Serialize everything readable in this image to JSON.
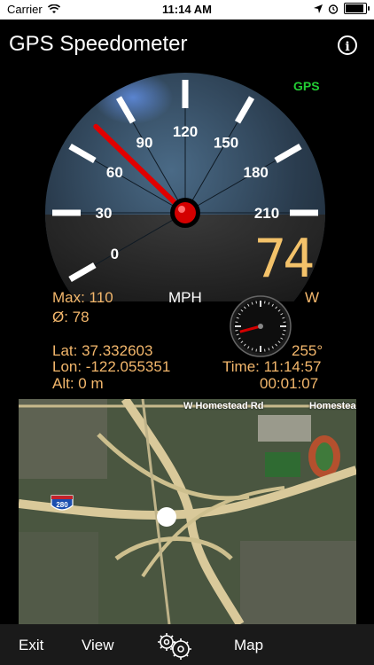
{
  "status_bar": {
    "carrier": "Carrier",
    "time": "11:14 AM",
    "battery_level": 0.9,
    "icons": [
      "wifi-icon",
      "location-arrow-icon",
      "alarm-icon",
      "battery-icon"
    ]
  },
  "header": {
    "title": "GPS Speedometer",
    "info_icon": "info-icon"
  },
  "gps_badge": "GPS",
  "gauge": {
    "tick_labels": [
      "0",
      "30",
      "60",
      "90",
      "120",
      "150",
      "180",
      "210"
    ],
    "min_value": 0,
    "max_value": 210,
    "needle_value": 74,
    "unit": "MPH",
    "colors": {
      "needle": "#e00000",
      "face": "#2c3e4e",
      "tick": "#ffffff"
    }
  },
  "readout": {
    "speed": "74",
    "max_text": "Max: 110",
    "avg_text": "Ø: 78",
    "heading": "W"
  },
  "compass": {
    "heading_degrees": 255,
    "label": "W"
  },
  "location": {
    "lat_text": "Lat: 37.332603",
    "lon_text": "Lon: -122.055351",
    "alt_text": "Alt: 0 m",
    "course_text": "255°",
    "time_text": "Time: 11:14:57",
    "elapsed_text": "00:01:07"
  },
  "map": {
    "street_1": "W Homestead Rd",
    "street_2": "Homestead",
    "highway_shield": "280"
  },
  "toolbar": {
    "exit_label": "Exit",
    "view_label": "View",
    "settings_icon": "settings-gears-icon",
    "map_label": "Map"
  },
  "colors": {
    "accent_orange": "#f3b76c",
    "gps_green": "#22cc33",
    "speed_digits": "#f3c26a"
  }
}
